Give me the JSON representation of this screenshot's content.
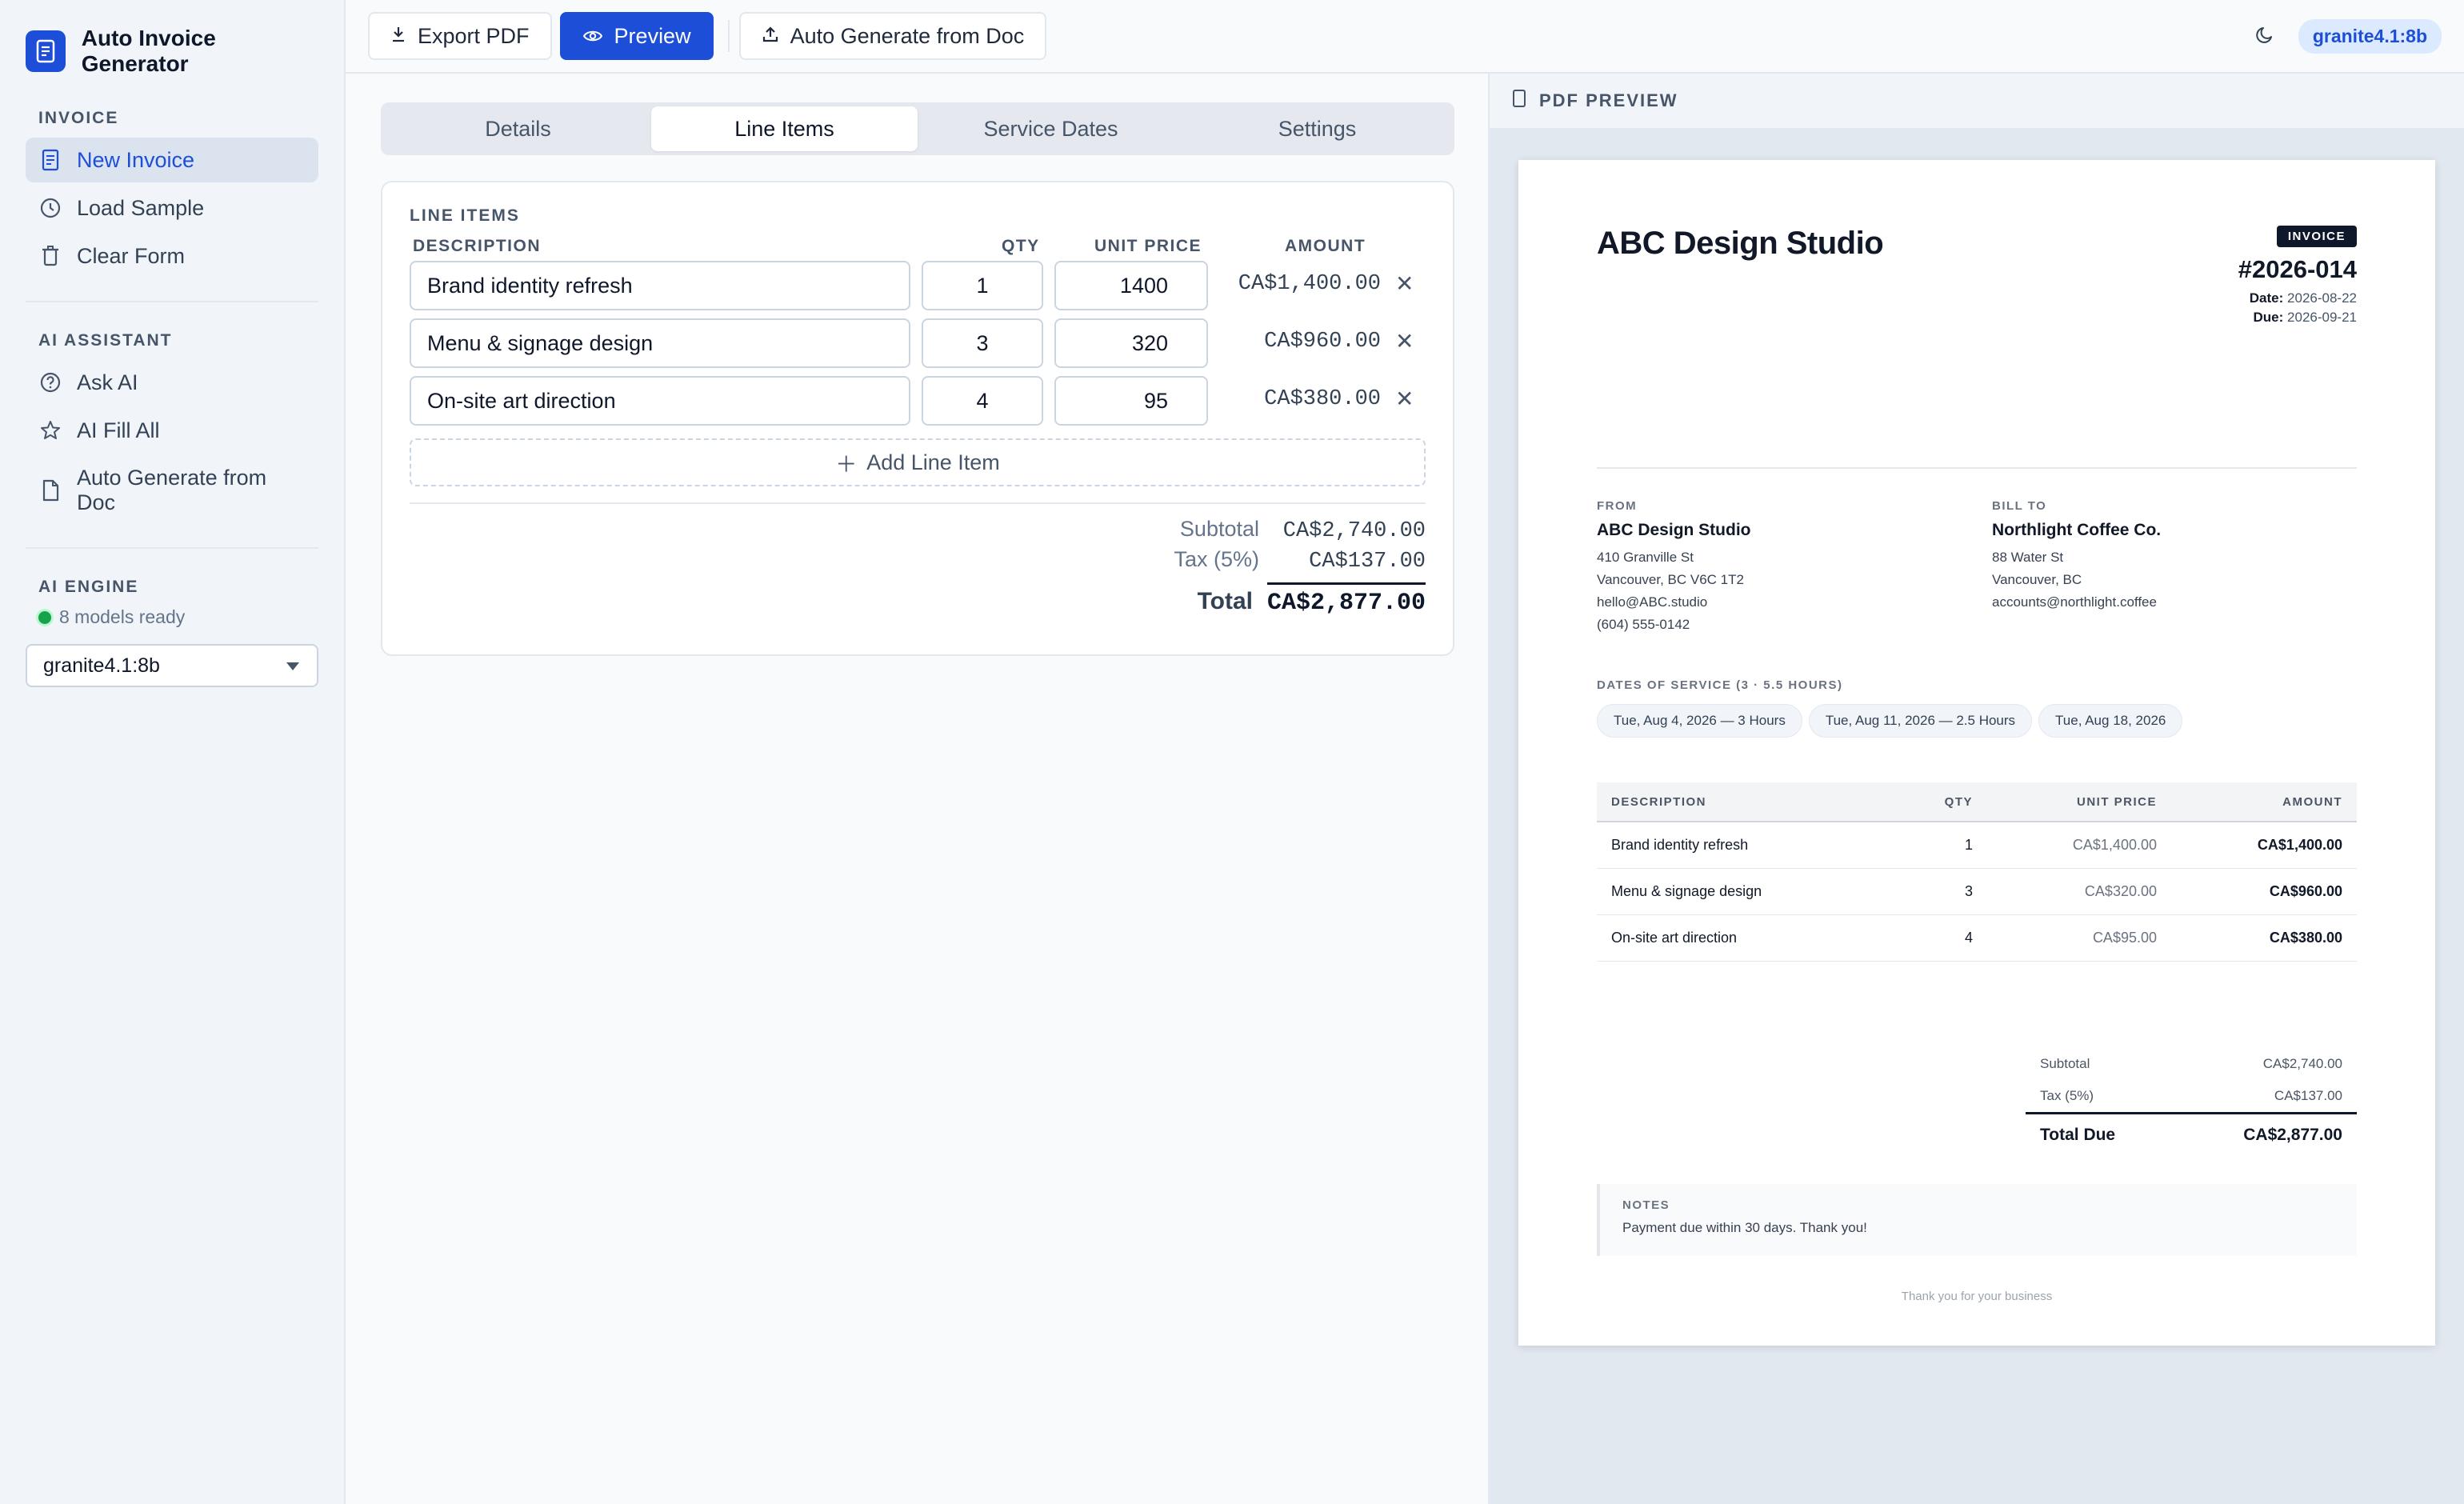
{
  "app": {
    "title": "Auto Invoice Generator",
    "accent_color": "#1d4ed8"
  },
  "sidebar": {
    "invoice_section": "INVOICE",
    "invoice_items": [
      {
        "label": "New Invoice",
        "icon": "document-icon",
        "active": true
      },
      {
        "label": "Load Sample",
        "icon": "clock-icon"
      },
      {
        "label": "Clear Form",
        "icon": "trash-icon"
      }
    ],
    "ai_section": "AI ASSISTANT",
    "ai_items": [
      {
        "label": "Ask AI",
        "icon": "help-circle-icon"
      },
      {
        "label": "AI Fill All",
        "icon": "star-icon"
      },
      {
        "label": "Auto Generate from Doc",
        "icon": "file-icon"
      }
    ],
    "engine_section": "AI ENGINE",
    "engine_status": "8 models ready",
    "engine_model": "granite4.1:8b"
  },
  "toolbar": {
    "export_label": "Export PDF",
    "preview_label": "Preview",
    "auto_generate_label": "Auto Generate from Doc",
    "model_badge": "granite4.1:8b"
  },
  "tabs": [
    {
      "label": "Details"
    },
    {
      "label": "Line Items",
      "active": true
    },
    {
      "label": "Service Dates"
    },
    {
      "label": "Settings"
    }
  ],
  "line_items": {
    "section_title": "LINE ITEMS",
    "headers": {
      "description": "DESCRIPTION",
      "qty": "QTY",
      "unit_price": "UNIT PRICE",
      "amount": "AMOUNT"
    },
    "rows": [
      {
        "description": "Brand identity refresh",
        "qty": "1",
        "unit_price": "1400",
        "amount": "CA$1,400.00"
      },
      {
        "description": "Menu & signage design",
        "qty": "3",
        "unit_price": "320",
        "amount": "CA$960.00"
      },
      {
        "description": "On-site art direction",
        "qty": "4",
        "unit_price": "95",
        "amount": "CA$380.00"
      }
    ],
    "add_label": "Add Line Item",
    "subtotal_label": "Subtotal",
    "subtotal_value": "CA$2,740.00",
    "tax_label": "Tax (5%)",
    "tax_value": "CA$137.00",
    "total_label": "Total",
    "total_value": "CA$2,877.00"
  },
  "preview": {
    "header_label": "PDF PREVIEW",
    "company": "ABC Design Studio",
    "badge": "INVOICE",
    "invoice_number": "#2026-014",
    "date_label": "Date:",
    "date_value": "2026-08-22",
    "due_label": "Due:",
    "due_value": "2026-09-21",
    "from": {
      "label": "FROM",
      "name": "ABC Design Studio",
      "lines": [
        "410 Granville St",
        "Vancouver, BC V6C 1T2",
        "hello@ABC.studio",
        "(604) 555-0142"
      ]
    },
    "bill_to": {
      "label": "BILL TO",
      "name": "Northlight Coffee Co.",
      "lines": [
        "88 Water St",
        "Vancouver, BC",
        "accounts@northlight.coffee"
      ]
    },
    "service_dates_label": "DATES OF SERVICE (3 · 5.5 HOURS)",
    "service_dates": [
      "Tue, Aug 4, 2026 — 3 Hours",
      "Tue, Aug 11, 2026 — 2.5 Hours",
      "Tue, Aug 18, 2026"
    ],
    "table_headers": {
      "description": "DESCRIPTION",
      "qty": "QTY",
      "unit_price": "UNIT PRICE",
      "amount": "AMOUNT"
    },
    "rows": [
      {
        "description": "Brand identity refresh",
        "qty": "1",
        "unit_price": "CA$1,400.00",
        "amount": "CA$1,400.00"
      },
      {
        "description": "Menu & signage design",
        "qty": "3",
        "unit_price": "CA$320.00",
        "amount": "CA$960.00"
      },
      {
        "description": "On-site art direction",
        "qty": "4",
        "unit_price": "CA$95.00",
        "amount": "CA$380.00"
      }
    ],
    "subtotal_label": "Subtotal",
    "subtotal_value": "CA$2,740.00",
    "tax_label": "Tax (5%)",
    "tax_value": "CA$137.00",
    "total_label": "Total Due",
    "total_value": "CA$2,877.00",
    "notes_label": "NOTES",
    "notes_text": "Payment due within 30 days. Thank you!",
    "footer": "Thank you for your business"
  }
}
